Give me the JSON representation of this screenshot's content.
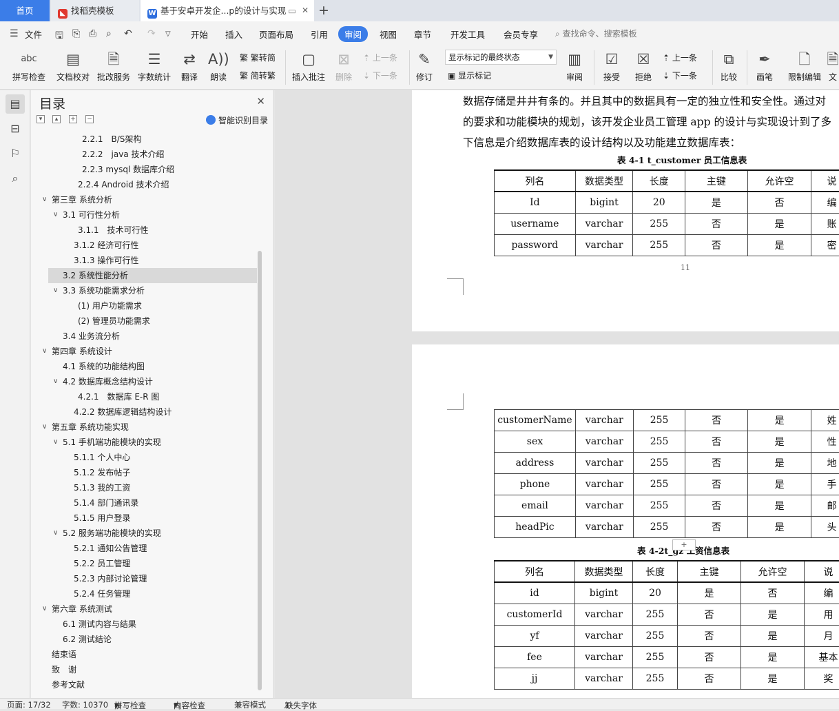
{
  "tabs": {
    "home": "首页",
    "template": "找稻壳模板",
    "document": "基于安卓开发企...p的设计与实现"
  },
  "menu": {
    "file": "文件",
    "items": [
      "开始",
      "插入",
      "页面布局",
      "引用",
      "审阅",
      "视图",
      "章节",
      "开发工具",
      "会员专享"
    ],
    "active": "审阅",
    "search": "查找命令、搜索模板"
  },
  "ribbon": {
    "spell_check": "拼写检查",
    "spell_icon": "abc",
    "doc_proof": "文档校对",
    "batch_service": "批改服务",
    "word_count": "字数统计",
    "translate": "翻译",
    "read_aloud": "朗读",
    "trad_to_simp": "繁转简",
    "simp_to_trad": "简转繁",
    "insert_comment": "插入批注",
    "delete": "删除",
    "prev_item": "上一条",
    "next_item": "下一条",
    "revise": "修订",
    "markup_state": "显示标记的最终状态",
    "show_markup": "显示标记",
    "review": "审阅",
    "accept": "接受",
    "reject": "拒绝",
    "prev_change": "上一条",
    "next_change": "下一条",
    "compare": "比较",
    "pen": "画笔",
    "restrict_edit": "限制编辑",
    "doc_cut": "文"
  },
  "toc": {
    "title": "目录",
    "smart": "智能识别目录",
    "items": [
      "2.2.1　B/S架构",
      "2.2.2　java 技术介绍",
      "2.2.3 mysql 数据库介绍",
      "2.2.4 Android 技术介绍",
      "第三章  系统分析",
      "3.1  可行性分析",
      "3.1.1　技术可行性",
      "3.1.2  经济可行性",
      "3.1.3  操作可行性",
      "3.2  系统性能分析",
      "3.3  系统功能需求分析",
      "(1)  用户功能需求",
      "(2)  管理员功能需求",
      "3.4  业务流分析",
      "第四章  系统设计",
      "4.1  系统的功能结构图",
      "4.2  数据库概念结构设计",
      "4.2.1　数据库 E-R 图",
      "4.2.2  数据库逻辑结构设计",
      "第五章  系统功能实现",
      "5.1  手机端功能模块的实现",
      "5.1.1 个人中心",
      "5.1.2 发布帖子",
      "5.1.3 我的工资",
      "5.1.4 部门通讯录",
      "5.1.5 用户登录",
      "5.2 服务端功能模块的实现",
      "5.2.1 通知公告管理",
      "5.2.2 员工管理",
      "5.2.3 内部讨论管理",
      "5.2.4 任务管理",
      "第六章  系统测试",
      "6.1  测试内容与结果",
      "6.2  测试结论",
      "结束语",
      "致　谢",
      "参考文献"
    ]
  },
  "document": {
    "lines": [
      "数据存储是井井有条的。并且其中的数据具有一定的独立性和安全性。通过对",
      "的要求和功能模块的规划，该开发企业员工管理 app 的设计与实现设计到了多",
      "下信息是介绍数据库表的设计结构以及功能建立数据库表："
    ],
    "caption1": "表 4-1   t_customer 员工信息表",
    "table1_header": [
      "列名",
      "数据类型",
      "长度",
      "主键",
      "允许空",
      "说"
    ],
    "table1_rows": [
      [
        "Id",
        "bigint",
        "20",
        "是",
        "否",
        "编"
      ],
      [
        "username",
        "varchar",
        "255",
        "否",
        "是",
        "账"
      ],
      [
        "password",
        "varchar",
        "255",
        "否",
        "是",
        "密"
      ]
    ],
    "page_number": "11",
    "table1b_rows": [
      [
        "customerName",
        "varchar",
        "255",
        "否",
        "是",
        "姓"
      ],
      [
        "sex",
        "varchar",
        "255",
        "否",
        "是",
        "性"
      ],
      [
        "address",
        "varchar",
        "255",
        "否",
        "是",
        "地"
      ],
      [
        "phone",
        "varchar",
        "255",
        "否",
        "是",
        "手"
      ],
      [
        "email",
        "varchar",
        "255",
        "否",
        "是",
        "邮"
      ],
      [
        "headPic",
        "varchar",
        "255",
        "否",
        "是",
        "头"
      ]
    ],
    "caption2": "表 4-2t_gz 工资信息表",
    "table2_header": [
      "列名",
      "数据类型",
      "长度",
      "主键",
      "允许空",
      "说"
    ],
    "table2_rows": [
      [
        "id",
        "bigint",
        "20",
        "是",
        "否",
        "编"
      ],
      [
        "customerId",
        "varchar",
        "255",
        "否",
        "是",
        "用"
      ],
      [
        "yf",
        "varchar",
        "255",
        "否",
        "是",
        "月"
      ],
      [
        "fee",
        "varchar",
        "255",
        "否",
        "是",
        "基本"
      ],
      [
        "jj",
        "varchar",
        "255",
        "否",
        "是",
        "奖"
      ]
    ]
  },
  "status": {
    "page": "页面: 17/32",
    "words": "字数: 10370",
    "spell": "拼写检查",
    "content_check": "内容检查",
    "compat": "兼容模式",
    "missing_font": "缺失字体"
  }
}
